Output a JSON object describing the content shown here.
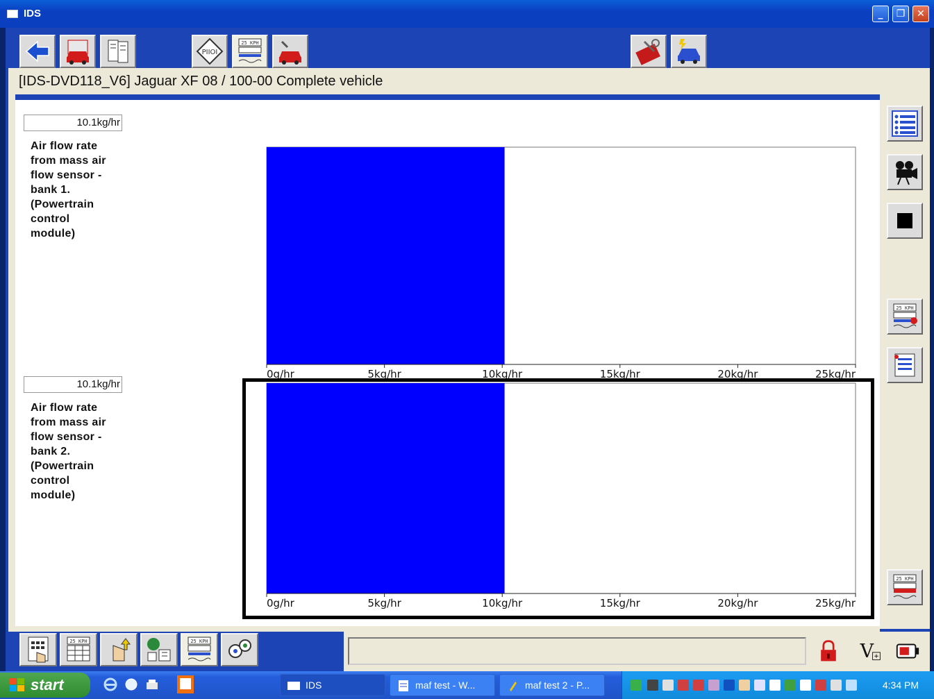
{
  "window": {
    "title": "IDS",
    "minimize_symbol": "_",
    "maximize_symbol": "❐",
    "close_symbol": "✕"
  },
  "toolbar": {
    "buttons": [
      {
        "icon": "back-arrow-icon"
      },
      {
        "icon": "vehicle-red-car-icon"
      },
      {
        "icon": "documents-icon"
      },
      {
        "icon": "pid-tag-icon"
      },
      {
        "icon": "datalogger-25kph-icon"
      },
      {
        "icon": "toolbox-car-icon"
      },
      {
        "icon": "toolbox-tools-icon"
      },
      {
        "icon": "car-lightning-icon"
      }
    ]
  },
  "session": {
    "vehicle_line": "[IDS-DVD118_V6]   Jaguar XF 08 / 100-00 Complete vehicle"
  },
  "gauges": [
    {
      "value_text": "10.1kg/hr",
      "label_lines": [
        "Air flow rate",
        "from mass air",
        "flow sensor -",
        "bank 1.",
        "(Powertrain",
        "control",
        "module)"
      ],
      "selected": false
    },
    {
      "value_text": "10.1kg/hr",
      "label_lines": [
        "Air flow rate",
        "from mass air",
        "flow sensor -",
        "bank 2.",
        "(Powertrain",
        "control",
        "module)"
      ],
      "selected": true
    }
  ],
  "chart_data": [
    {
      "type": "bar",
      "orientation": "horizontal",
      "categories": [
        "Air flow rate from mass air flow sensor - bank 1. (Powertrain control module)"
      ],
      "values": [
        10.1
      ],
      "unit": "kg/hr",
      "xlim": [
        0,
        25
      ],
      "tick_values": [
        0,
        5,
        10,
        15,
        20,
        25
      ],
      "tick_labels": [
        "0g/hr",
        "5kg/hr",
        "10kg/hr",
        "15kg/hr",
        "20kg/hr",
        "25kg/hr"
      ],
      "bar_color": "#0000ff",
      "grid": false
    },
    {
      "type": "bar",
      "orientation": "horizontal",
      "categories": [
        "Air flow rate from mass air flow sensor - bank 2. (Powertrain control module)"
      ],
      "values": [
        10.1
      ],
      "unit": "kg/hr",
      "xlim": [
        0,
        25
      ],
      "tick_values": [
        0,
        5,
        10,
        15,
        20,
        25
      ],
      "tick_labels": [
        "0g/hr",
        "5kg/hr",
        "10kg/hr",
        "15kg/hr",
        "20kg/hr",
        "25kg/hr"
      ],
      "bar_color": "#0000ff",
      "grid": false
    }
  ],
  "right_panel": {
    "buttons": [
      {
        "icon": "list-view-icon"
      },
      {
        "icon": "movie-camera-icon"
      },
      {
        "icon": "stop-icon"
      },
      {
        "icon": "datalogger-edit-icon"
      },
      {
        "icon": "datalogger-list-icon"
      },
      {
        "icon": "datalogger-red-icon"
      }
    ]
  },
  "bottom_toolbar": {
    "buttons": [
      {
        "icon": "keypad-hand-icon"
      },
      {
        "icon": "datalogger-grid-icon"
      },
      {
        "icon": "hand-arrows-icon"
      },
      {
        "icon": "globe-settings-icon"
      },
      {
        "icon": "datalogger-active-icon"
      },
      {
        "icon": "gears-icon"
      }
    ],
    "status_icons": [
      {
        "icon": "lock-icon"
      },
      {
        "icon": "voltage-meter-icon",
        "text": "V"
      },
      {
        "icon": "battery-connector-icon"
      }
    ]
  },
  "taskbar": {
    "start_label": "start",
    "tasks": [
      {
        "label": "IDS",
        "active": true
      },
      {
        "label": "maf test - W...",
        "active": false
      },
      {
        "label": "maf test 2 - P...",
        "active": false
      }
    ],
    "clock": "4:34 PM"
  },
  "colors": {
    "accent_blue": "#1c44b4",
    "bar_blue": "#0000ff",
    "panel": "#ece9d8"
  }
}
